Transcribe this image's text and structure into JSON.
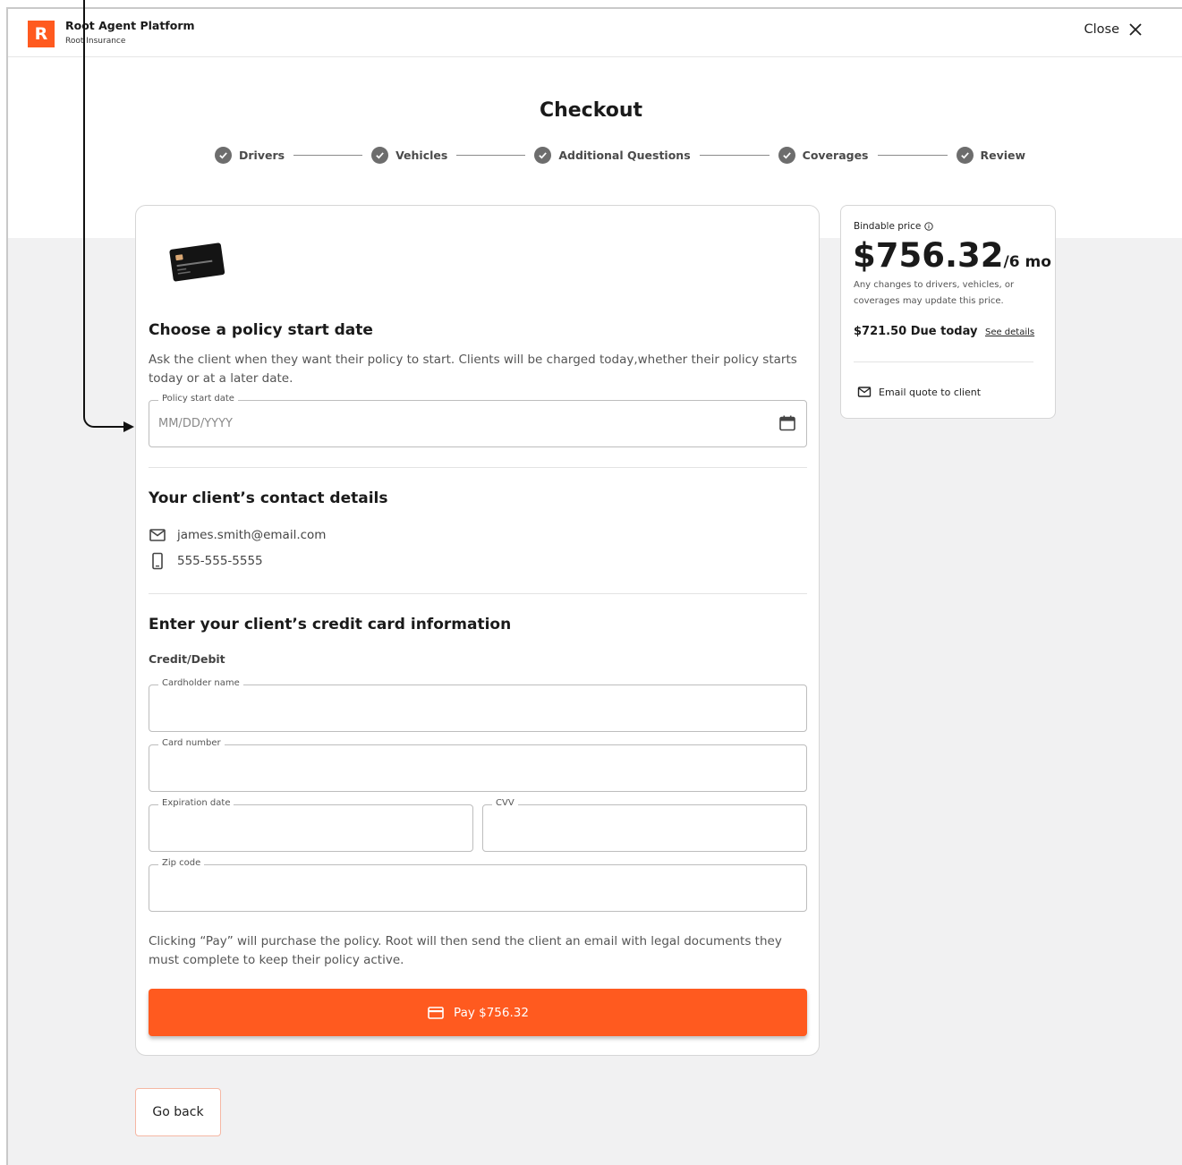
{
  "header": {
    "logo_letter": "R",
    "app_title": "Root Agent Platform",
    "app_subtitle": "Root Insurance",
    "close_label": "Close"
  },
  "page": {
    "title": "Checkout"
  },
  "stepper": {
    "steps": [
      {
        "label": "Drivers",
        "status": "complete"
      },
      {
        "label": "Vehicles",
        "status": "complete"
      },
      {
        "label": "Additional Questions",
        "status": "complete"
      },
      {
        "label": "Coverages",
        "status": "complete"
      },
      {
        "label": "Review",
        "status": "complete"
      }
    ]
  },
  "policy_start": {
    "title": "Choose a policy start date",
    "description": "Ask the client when they want their policy to start. Clients will be charged today,whether their policy starts today or at a later date.",
    "field_label": "Policy start date",
    "placeholder": "MM/DD/YYYY",
    "value": ""
  },
  "contact": {
    "title": "Your client’s contact details",
    "email": "james.smith@email.com",
    "phone": "555-555-5555"
  },
  "card_info": {
    "title": "Enter your client’s credit card information",
    "subhead": "Credit/Debit",
    "fields": {
      "cardholder_name": {
        "label": "Cardholder name",
        "value": ""
      },
      "card_number": {
        "label": "Card number",
        "value": ""
      },
      "expiration_date": {
        "label": "Expiration date",
        "value": ""
      },
      "cvv": {
        "label": "CVV",
        "value": ""
      },
      "zip_code": {
        "label": "Zip code",
        "value": ""
      }
    },
    "disclaimer": "Clicking “Pay” will purchase the policy. Root will then send the client an email with legal documents they must complete to keep their policy active.",
    "pay_label": "Pay $756.32"
  },
  "price_panel": {
    "bindable_label": "Bindable price",
    "price": "$756.32",
    "period": "/6 mo",
    "note": "Any changes to drivers, vehicles, or coverages may update this price.",
    "due_today": "$721.50 Due today",
    "see_details": "See details",
    "email_quote": "Email quote to client"
  },
  "footer": {
    "go_back_label": "Go back"
  },
  "colors": {
    "brand": "#ff5a1f",
    "page_bg": "#f1f1f2",
    "step_icon": "#6d6d6d"
  },
  "icons": [
    "close-icon",
    "check-icon",
    "credit-card-image",
    "calendar-icon",
    "mail-icon",
    "phone-icon",
    "card-icon",
    "info-icon"
  ]
}
